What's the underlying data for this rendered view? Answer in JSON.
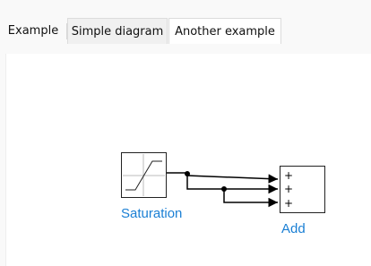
{
  "tabs": [
    {
      "label": "Example"
    },
    {
      "label": "Simple diagram"
    },
    {
      "label": "Another example"
    }
  ],
  "diagram": {
    "saturation_label": "Saturation",
    "add_label": "Add",
    "add_signs": [
      "+",
      "+",
      "+"
    ],
    "label_color": "#1a7fd4"
  }
}
